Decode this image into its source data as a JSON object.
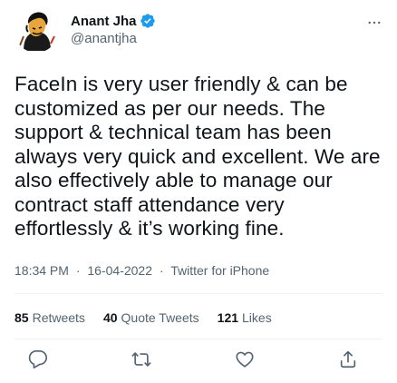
{
  "tweet": {
    "author": {
      "display_name": "Anant Jha",
      "handle": "@anantjha",
      "verified": true,
      "avatar_icon": "avatar-icon"
    },
    "text": "FaceIn is very user friendly & can be customized as per our needs. The support & technical team has been always very quick and excellent. We are also effectively able to manage our contract staff attendance very effortlessly & it’s working fine.",
    "meta": {
      "time": "18:34 PM",
      "date": "16-04-2022",
      "source": "Twitter for iPhone",
      "separator": "·"
    },
    "stats": [
      {
        "count": "85",
        "label": "Retweets"
      },
      {
        "count": "40",
        "label": "Quote Tweets"
      },
      {
        "count": "121",
        "label": "Likes"
      }
    ],
    "actions": [
      {
        "name": "reply",
        "icon": "reply-icon"
      },
      {
        "name": "retweet",
        "icon": "retweet-icon"
      },
      {
        "name": "like",
        "icon": "like-icon"
      },
      {
        "name": "share",
        "icon": "share-icon"
      }
    ]
  },
  "colors": {
    "text_primary": "#0f1419",
    "text_secondary": "#536471",
    "verified_blue": "#1d9bf0",
    "divider": "#eff3f4"
  }
}
